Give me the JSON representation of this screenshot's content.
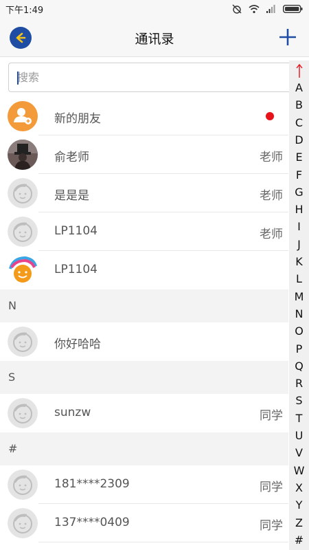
{
  "status_bar": {
    "time": "下午1:49"
  },
  "header": {
    "title": "通讯录"
  },
  "search": {
    "placeholder": "搜索"
  },
  "new_friends": {
    "label": "新的朋友"
  },
  "contacts": [
    {
      "name": "俞老师",
      "tag": "老师"
    },
    {
      "name": "是是是",
      "tag": "老师"
    },
    {
      "name": "LP1104",
      "tag": "老师"
    },
    {
      "name": "LP1104",
      "tag": ""
    }
  ],
  "sections": [
    {
      "letter": "N",
      "contacts": [
        {
          "name": "你好哈哈",
          "tag": ""
        }
      ]
    },
    {
      "letter": "S",
      "contacts": [
        {
          "name": "sunzw",
          "tag": "同学"
        }
      ]
    },
    {
      "letter": "#",
      "contacts": [
        {
          "name": "181****2309",
          "tag": "同学"
        },
        {
          "name": "137****0409",
          "tag": "同学"
        }
      ]
    }
  ],
  "index_letters": [
    "A",
    "B",
    "C",
    "D",
    "E",
    "F",
    "G",
    "H",
    "I",
    "J",
    "K",
    "L",
    "M",
    "N",
    "O",
    "P",
    "Q",
    "R",
    "S",
    "T",
    "U",
    "V",
    "W",
    "X",
    "Y",
    "Z",
    "#"
  ],
  "colors": {
    "accent": "#1f4da3",
    "badge": "#e8121b",
    "new_friend_avatar": "#f39a3b",
    "back_arrow": "#f3c21b"
  }
}
